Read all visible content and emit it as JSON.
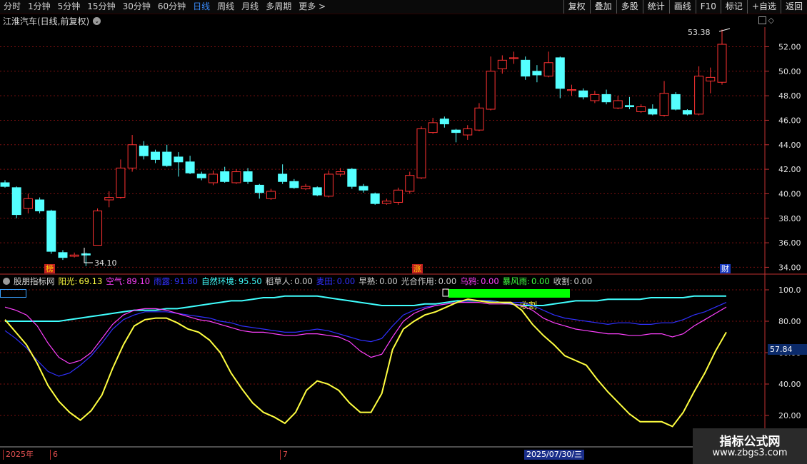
{
  "toolbar": {
    "periods": [
      "分时",
      "1分钟",
      "5分钟",
      "15分钟",
      "30分钟",
      "60分钟",
      "日线",
      "周线",
      "月线",
      "多周期",
      "更多 >"
    ],
    "active_index": 6,
    "buttons": [
      "复权",
      "叠加",
      "多股",
      "统计",
      "画线",
      "F10",
      "标记",
      "+自选",
      "返回"
    ]
  },
  "stock": {
    "title": "江淮汽车(日线,前复权)"
  },
  "price_axis": {
    "ticks": [
      "52.00",
      "50.00",
      "48.00",
      "46.00",
      "44.00",
      "42.00",
      "40.00",
      "38.00",
      "36.00",
      "34.00"
    ]
  },
  "annotations": {
    "high": "53.38",
    "low": "34.10"
  },
  "badges": {
    "b1": "榜",
    "b2": "涨",
    "b3": "财"
  },
  "indicator": {
    "name": "股朋指标网",
    "items": [
      {
        "label": "阳光:",
        "value": "69.13",
        "color": "#ffff40"
      },
      {
        "label": "空气:",
        "value": "89.10",
        "color": "#ff40ff"
      },
      {
        "label": "雨露:",
        "value": "91.80",
        "color": "#3030ff"
      },
      {
        "label": "自然环境:",
        "value": "95.50",
        "color": "#40ffff"
      },
      {
        "label": "稻草人:",
        "value": "0.00",
        "color": "#d0d0d0"
      },
      {
        "label": "麦田:",
        "value": "0.00",
        "color": "#3030ff"
      },
      {
        "label": "早熟:",
        "value": "0.00",
        "color": "#d0d0d0"
      },
      {
        "label": "光合作用:",
        "value": "0.00",
        "color": "#d0d0d0"
      },
      {
        "label": "乌鸦:",
        "value": "0.00",
        "color": "#ff40ff"
      },
      {
        "label": "暴风雨:",
        "value": "0.00",
        "color": "#40ff40"
      },
      {
        "label": "收割:",
        "value": "0.00",
        "color": "#d0d0d0"
      }
    ],
    "harvest_label": "收割",
    "axis_ticks": [
      "100.0",
      "80.00",
      "60.00",
      "40.00",
      "20.00"
    ],
    "highlight_value": "57.84"
  },
  "dates": {
    "d1": "2025年",
    "d2": "6",
    "d3": "7",
    "highlight": "2025/07/30/三"
  },
  "watermark": {
    "title": "指标公式网",
    "url": "www.zbgs3.com"
  },
  "colors": {
    "up": "#ff3232",
    "down": "#54ffff",
    "sun": "#ffff40",
    "air": "#ff40ff",
    "dew": "#3030ff",
    "env": "#40ffff",
    "harvest_bar": "#00ff00"
  },
  "chart_data": [
    {
      "type": "candlestick",
      "title": "江淮汽车(日线,前复权)",
      "ylim": [
        33.5,
        53.6
      ],
      "fields": [
        "open",
        "close",
        "high",
        "low"
      ],
      "candles": [
        [
          40.9,
          40.6,
          41.1,
          40.5
        ],
        [
          40.5,
          38.3,
          40.6,
          38.0
        ],
        [
          38.8,
          39.6,
          40.0,
          38.4
        ],
        [
          39.5,
          38.6,
          39.7,
          38.4
        ],
        [
          38.6,
          35.3,
          38.7,
          35.1
        ],
        [
          35.2,
          34.8,
          35.4,
          34.6
        ],
        [
          34.9,
          35.0,
          35.2,
          34.8
        ],
        [
          35.1,
          35.0,
          35.2,
          34.1
        ],
        [
          35.8,
          38.6,
          38.8,
          35.8
        ],
        [
          39.5,
          39.7,
          40.2,
          38.9
        ],
        [
          39.7,
          42.1,
          42.8,
          39.6
        ],
        [
          42.1,
          44.0,
          44.8,
          41.8
        ],
        [
          43.9,
          43.1,
          44.3,
          42.8
        ],
        [
          43.4,
          42.8,
          43.6,
          42.5
        ],
        [
          43.4,
          42.3,
          44.0,
          42.2
        ],
        [
          43.0,
          42.6,
          43.4,
          41.4
        ],
        [
          42.6,
          41.7,
          43.1,
          41.6
        ],
        [
          41.6,
          41.3,
          41.8,
          41.1
        ],
        [
          40.9,
          41.6,
          41.9,
          40.7
        ],
        [
          41.8,
          41.0,
          42.2,
          40.9
        ],
        [
          40.9,
          41.8,
          42.0,
          40.8
        ],
        [
          41.8,
          41.0,
          42.1,
          40.8
        ],
        [
          40.7,
          40.1,
          40.8,
          39.6
        ],
        [
          39.6,
          40.2,
          40.4,
          39.5
        ],
        [
          41.6,
          41.0,
          42.4,
          40.8
        ],
        [
          41.0,
          40.5,
          41.2,
          40.4
        ],
        [
          40.4,
          40.6,
          40.8,
          40.3
        ],
        [
          40.5,
          39.9,
          40.6,
          39.8
        ],
        [
          39.8,
          41.6,
          41.9,
          39.7
        ],
        [
          41.6,
          41.8,
          42.1,
          41.4
        ],
        [
          42.0,
          40.6,
          42.1,
          40.4
        ],
        [
          40.6,
          40.3,
          40.8,
          40.1
        ],
        [
          40.0,
          39.2,
          40.1,
          39.1
        ],
        [
          39.2,
          39.4,
          39.6,
          39.1
        ],
        [
          39.3,
          40.3,
          40.5,
          39.1
        ],
        [
          40.2,
          41.5,
          41.8,
          40.0
        ],
        [
          41.3,
          45.3,
          45.5,
          41.2
        ],
        [
          45.0,
          45.8,
          46.2,
          44.9
        ],
        [
          46.1,
          45.7,
          46.3,
          45.4
        ],
        [
          45.2,
          45.0,
          45.3,
          44.2
        ],
        [
          44.8,
          45.3,
          45.6,
          44.4
        ],
        [
          45.2,
          47.0,
          47.4,
          45.1
        ],
        [
          46.9,
          50.0,
          51.2,
          46.8
        ],
        [
          50.2,
          50.9,
          51.3,
          49.8
        ],
        [
          51.1,
          51.1,
          51.6,
          50.6
        ],
        [
          50.9,
          49.6,
          51.2,
          49.3
        ],
        [
          50.0,
          49.7,
          50.5,
          49.1
        ],
        [
          49.6,
          50.7,
          51.6,
          49.5
        ],
        [
          51.1,
          48.6,
          51.2,
          47.8
        ],
        [
          48.5,
          48.5,
          48.9,
          48.0
        ],
        [
          48.4,
          47.9,
          48.6,
          47.7
        ],
        [
          47.6,
          48.1,
          48.4,
          47.4
        ],
        [
          48.1,
          47.5,
          48.5,
          47.3
        ],
        [
          47.0,
          47.6,
          48.0,
          46.9
        ],
        [
          47.2,
          47.1,
          47.9,
          46.9
        ],
        [
          46.7,
          47.1,
          47.3,
          46.6
        ],
        [
          46.9,
          46.5,
          47.3,
          46.4
        ],
        [
          46.4,
          48.2,
          49.2,
          46.3
        ],
        [
          48.1,
          46.9,
          48.3,
          46.8
        ],
        [
          46.8,
          46.5,
          46.9,
          46.4
        ],
        [
          46.5,
          49.6,
          50.4,
          46.4
        ],
        [
          49.2,
          49.5,
          50.3,
          48.2
        ],
        [
          49.1,
          52.2,
          53.4,
          48.9
        ]
      ]
    },
    {
      "type": "line",
      "ylim": [
        7,
        107
      ],
      "series": [
        {
          "name": "阳光",
          "values": [
            81,
            73,
            65,
            53,
            39,
            29,
            22,
            17,
            23,
            33,
            50,
            65,
            77,
            81,
            82,
            82,
            79,
            75,
            73,
            68,
            60,
            47,
            37,
            28,
            22,
            19,
            15,
            22,
            36,
            42,
            40,
            36,
            28,
            22,
            22,
            34,
            62,
            75,
            80,
            84,
            86,
            89,
            92,
            94,
            93,
            92,
            92,
            92,
            87,
            78,
            71,
            65,
            58,
            55,
            52,
            43,
            35,
            28,
            21,
            16,
            16,
            16,
            13,
            22,
            35,
            47,
            61,
            73
          ]
        },
        {
          "name": "空气",
          "values": [
            89,
            87,
            84,
            77,
            66,
            57,
            53,
            55,
            60,
            69,
            78,
            84,
            87,
            88,
            88,
            87,
            85,
            83,
            81,
            80,
            78,
            76,
            74,
            73,
            73,
            72,
            71,
            71,
            72,
            72,
            71,
            70,
            67,
            61,
            57,
            59,
            70,
            80,
            85,
            88,
            90,
            91,
            92,
            92,
            92,
            91,
            91,
            91,
            90,
            87,
            82,
            79,
            77,
            75,
            74,
            73,
            72,
            72,
            71,
            71,
            72,
            72,
            70,
            72,
            77,
            81,
            85,
            89
          ]
        },
        {
          "name": "雨露",
          "values": [
            74,
            69,
            63,
            55,
            48,
            45,
            47,
            52,
            58,
            66,
            75,
            81,
            84,
            86,
            86,
            86,
            85,
            84,
            83,
            82,
            80,
            79,
            77,
            76,
            75,
            74,
            73,
            73,
            74,
            75,
            74,
            72,
            70,
            68,
            67,
            69,
            77,
            84,
            87,
            89,
            90,
            91,
            92,
            93,
            93,
            93,
            92,
            92,
            92,
            90,
            87,
            84,
            82,
            81,
            80,
            79,
            78,
            79,
            79,
            78,
            78,
            79,
            79,
            81,
            84,
            86,
            89,
            92
          ]
        },
        {
          "name": "自然环境",
          "values": [
            80,
            80,
            80,
            80,
            80,
            80,
            81,
            82,
            83,
            84,
            85,
            86,
            87,
            87,
            87,
            88,
            88,
            89,
            90,
            91,
            92,
            93,
            93,
            94,
            95,
            95,
            96,
            96,
            96,
            96,
            95,
            94,
            93,
            92,
            91,
            90,
            90,
            90,
            90,
            91,
            91,
            92,
            93,
            93,
            93,
            93,
            92,
            91,
            90,
            90,
            90,
            91,
            92,
            93,
            93,
            93,
            94,
            94,
            94,
            94,
            95,
            95,
            95,
            95,
            96,
            96,
            96,
            96
          ]
        }
      ]
    }
  ]
}
